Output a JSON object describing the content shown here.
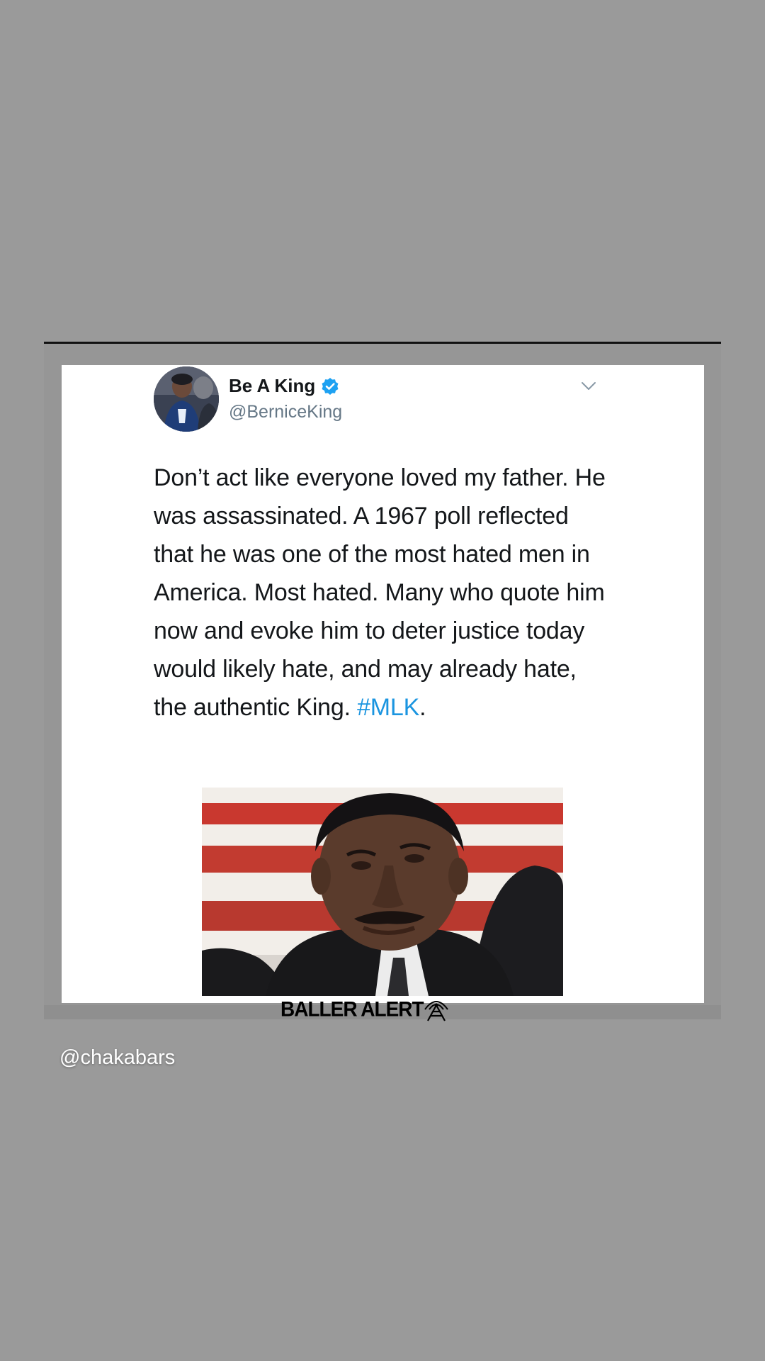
{
  "story": {
    "mention": "@chakabars"
  },
  "tweet": {
    "display_name": "Be A King",
    "handle": "@BerniceKing",
    "verified": true,
    "verified_color": "#1da1f2",
    "text_before_hashtag": "Don’t act like everyone loved my father. He was assassinated. A 1967 poll reflected that he was one of the most hated men in America. Most hated. Many who quote him now and evoke him to deter justice today would likely hate, and may already hate, the authentic King. ",
    "hashtag": "#MLK",
    "text_after_hashtag": ".",
    "hashtag_color": "#1b95e0",
    "menu_icon": "chevron-down-icon",
    "photo_icon": "portrait-photo"
  },
  "watermark": {
    "text": "BALLER ALERT",
    "icon": "broadcast-tower-icon"
  }
}
